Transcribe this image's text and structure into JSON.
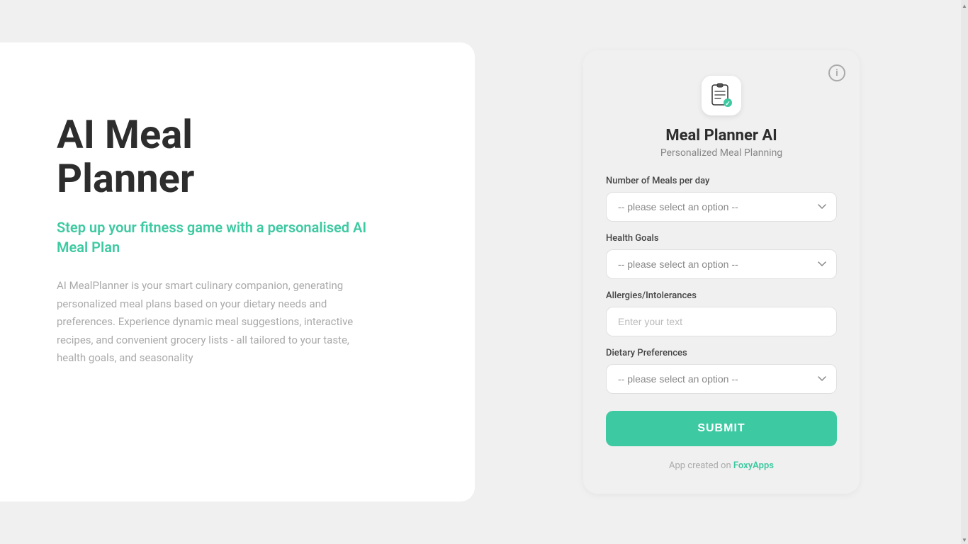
{
  "left": {
    "main_title": "AI Meal\nPlanner",
    "subtitle": "Step up your fitness game with a personalised AI Meal Plan",
    "description": "AI MealPlanner is your smart culinary companion, generating personalized meal plans based on your dietary needs and preferences. Experience dynamic meal suggestions, interactive recipes, and convenient grocery lists - all tailored to your taste, health goals, and seasonality"
  },
  "form": {
    "app_icon": "📋",
    "title": "Meal Planner AI",
    "subtitle": "Personalized Meal Planning",
    "info_icon_label": "i",
    "fields": {
      "meals_per_day": {
        "label": "Number of Meals per day",
        "placeholder": "-- please select an option --"
      },
      "health_goals": {
        "label": "Health Goals",
        "placeholder": "-- please select an option --"
      },
      "allergies": {
        "label": "Allergies/Intolerances",
        "placeholder": "Enter your text"
      },
      "dietary_preferences": {
        "label": "Dietary Preferences",
        "placeholder": "-- please select an option --"
      }
    },
    "submit_label": "SUBMIT",
    "footer_text": "App created on ",
    "footer_link_text": "FoxyApps"
  },
  "colors": {
    "accent": "#3dc9a1",
    "title": "#2d2d2d",
    "description": "#aaaaaa",
    "card_bg": "#f0f0f0",
    "page_bg": "#f0f0f0"
  }
}
